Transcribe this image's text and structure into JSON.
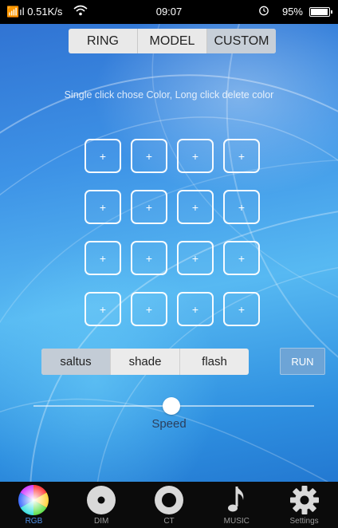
{
  "status_bar": {
    "network": "📶ıl 0.51K/s",
    "wifi_icon": "wifi-icon",
    "time": "09:07",
    "battery_text": "95%",
    "alarm_icon": "alarm-icon",
    "battery_level": 0.95
  },
  "top_tabs": [
    {
      "label": "RING",
      "active": false
    },
    {
      "label": "MODEL",
      "active": false
    },
    {
      "label": "CUSTOM",
      "active": true
    }
  ],
  "hint": "Single click chose Color, Long click delete color",
  "color_slots": {
    "slot_label": "+",
    "count": 16,
    "columns": 4
  },
  "modes": [
    {
      "label": "saltus",
      "active": true
    },
    {
      "label": "shade",
      "active": false
    },
    {
      "label": "flash",
      "active": false
    }
  ],
  "run_label": "RUN",
  "speed": {
    "label": "Speed",
    "value": 0.5
  },
  "bottom_nav": [
    {
      "label": "RGB",
      "icon": "color-wheel-icon",
      "active": true
    },
    {
      "label": "DIM",
      "icon": "dim-disc-icon",
      "active": false
    },
    {
      "label": "CT",
      "icon": "ct-ring-icon",
      "active": false
    },
    {
      "label": "MUSIC",
      "icon": "music-note-icon",
      "active": false
    },
    {
      "label": "Settings",
      "icon": "gear-icon",
      "active": false
    }
  ],
  "colors": {
    "active_nav": "#4f8fe6",
    "background_blue": "#3d92e6",
    "run_button": "#6da4d6"
  }
}
